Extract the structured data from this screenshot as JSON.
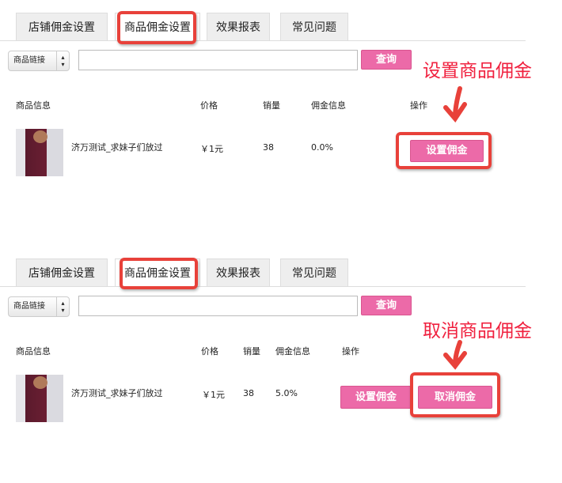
{
  "tabs": [
    "店铺佣金设置",
    "商品佣金设置",
    "效果报表",
    "常见问题"
  ],
  "search": {
    "select_value": "商品链接",
    "input_value": "",
    "query_label": "查询"
  },
  "columns": [
    "商品信息",
    "价格",
    "销量",
    "佣金信息",
    "操作"
  ],
  "panels": [
    {
      "annotation": "设置商品佣金",
      "product": {
        "name": "济万测试_求妹子们放过",
        "price": "￥1元",
        "sales": "38",
        "commission": "0.0%"
      },
      "actions": [
        "设置佣金"
      ]
    },
    {
      "annotation": "取消商品佣金",
      "product": {
        "name": "济万测试_求妹子们放过",
        "price": "￥1元",
        "sales": "38",
        "commission": "5.0%"
      },
      "actions": [
        "设置佣金",
        "取消佣金"
      ]
    }
  ],
  "colors": {
    "accent": "#ec6aa8",
    "highlight": "#e8413a",
    "annotation": "#f0213f"
  }
}
